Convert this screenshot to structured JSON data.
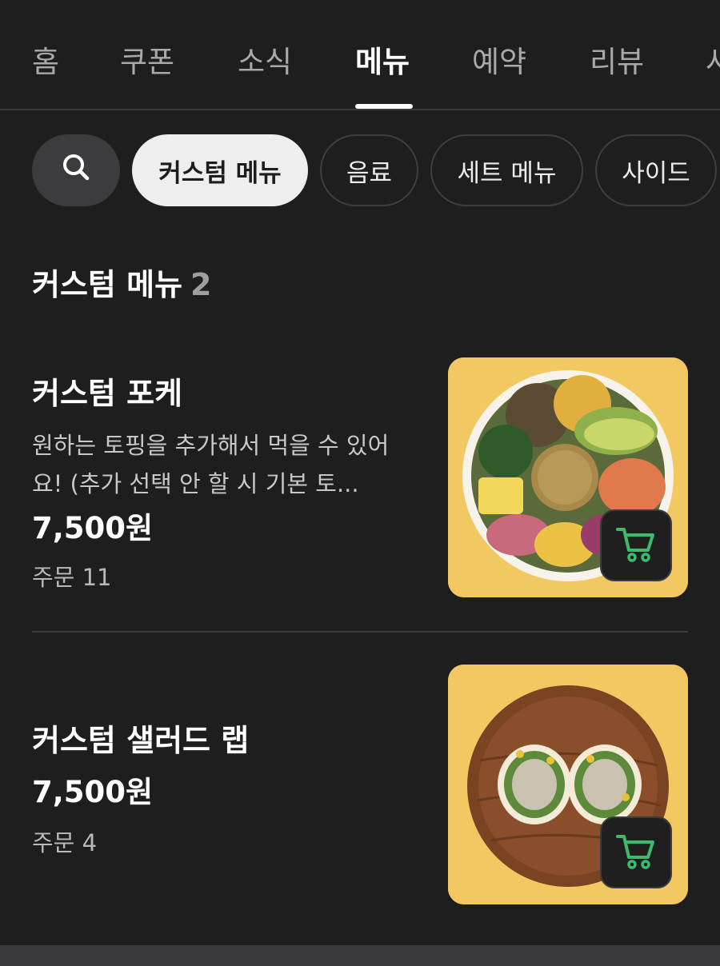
{
  "tabs": [
    {
      "label": "홈"
    },
    {
      "label": "쿠폰"
    },
    {
      "label": "소식"
    },
    {
      "label": "메뉴"
    },
    {
      "label": "예약"
    },
    {
      "label": "리뷰"
    },
    {
      "label": "사"
    }
  ],
  "active_tab": "메뉴",
  "filters": {
    "search_icon": "search-icon",
    "chips": [
      {
        "label": "커스텀 메뉴",
        "selected": true
      },
      {
        "label": "음료",
        "selected": false
      },
      {
        "label": "세트 메뉴",
        "selected": false
      },
      {
        "label": "사이드",
        "selected": false
      }
    ]
  },
  "section": {
    "title": "커스텀 메뉴",
    "count": "2"
  },
  "items": [
    {
      "name": "커스텀 포케",
      "description": "원하는 토핑을 추가해서 먹을 수 있어요! (추가 선택 안 할 시 기본 토...",
      "price": "7,500원",
      "orders": "주문 11",
      "image": "poke-bowl-photo",
      "cart_icon": "cart-icon"
    },
    {
      "name": "커스텀 샐러드 랩",
      "price": "7,500원",
      "orders": "주문 4",
      "image": "salad-wrap-photo",
      "cart_icon": "cart-icon"
    }
  ],
  "colors": {
    "background": "#1e1e1f",
    "chip_selected": "#eeeeee",
    "image_background": "#f2c862",
    "cart_icon": "#3fba6a"
  }
}
